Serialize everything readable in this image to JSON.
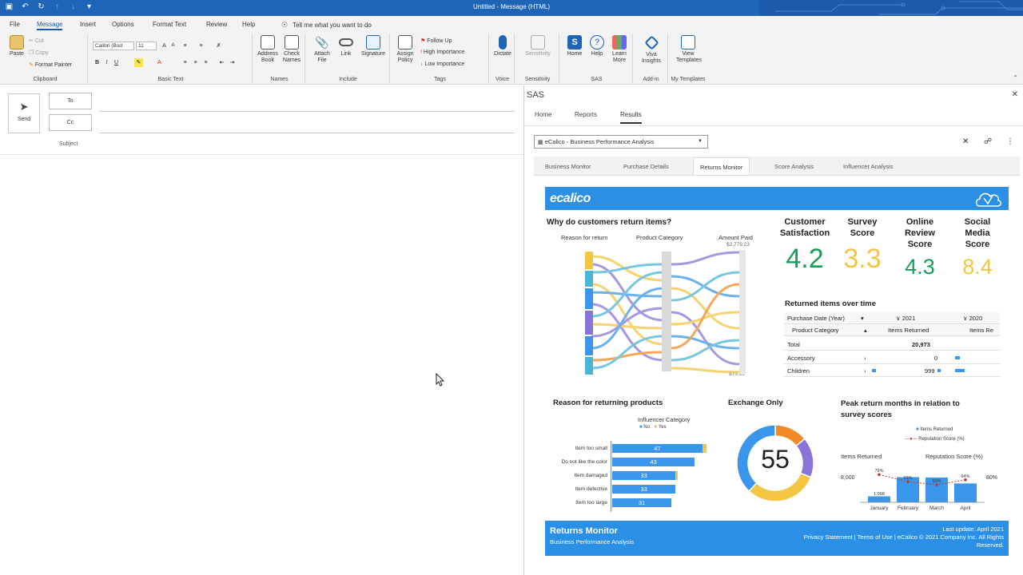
{
  "window": {
    "title": "Untitled - Message (HTML)"
  },
  "menu_tabs": [
    "File",
    "Message",
    "Insert",
    "Options",
    "Format Text",
    "Review",
    "Help"
  ],
  "tell_me": "Tell me what you want to do",
  "ribbon": {
    "clipboard": {
      "label": "Clipboard",
      "paste": "Paste",
      "cut": "Cut",
      "copy": "Copy",
      "format_painter": "Format Painter"
    },
    "basic_text": {
      "label": "Basic Text",
      "font": "Calibri (Bod",
      "size": "11"
    },
    "names": {
      "label": "Names",
      "address_book": [
        "Address",
        "Book"
      ],
      "check_names": [
        "Check",
        "Names"
      ]
    },
    "include": {
      "label": "Include",
      "attach_file": [
        "Attach",
        "File"
      ],
      "link": [
        "Link"
      ],
      "signature": [
        "Signature"
      ]
    },
    "tags": {
      "label": "Tags",
      "assign_policy": [
        "Assign",
        "Policy"
      ],
      "follow_up": "Follow Up",
      "high_importance": "High Importance",
      "low_importance": "Low Importance"
    },
    "voice": {
      "label": "Voice",
      "dictate": [
        "Dictate"
      ]
    },
    "sensitivity": {
      "label": "Sensitivity",
      "sensitivity": [
        "Sensitivity"
      ]
    },
    "sas": {
      "label": "SAS",
      "home": [
        "Home"
      ],
      "help": [
        "Help"
      ],
      "learn_more": [
        "Learn",
        "More"
      ]
    },
    "addin": {
      "label": "Add-in",
      "viva": [
        "Viva",
        "Insights"
      ]
    },
    "templates": {
      "label": "My Templates",
      "view": [
        "View",
        "Templates"
      ]
    }
  },
  "compose": {
    "send": "Send",
    "to": "To",
    "cc": "Cc",
    "subject": "Subject"
  },
  "sas_pane": {
    "title": "SAS",
    "tabs": [
      "Home",
      "Reports",
      "Results"
    ],
    "active_tab": "Results",
    "report_select": "eCalico - Business Performance Analysis",
    "report_tabs": [
      "Business Monitor",
      "Purchase Details",
      "Returns Monitor",
      "Score Analysis",
      "Influencer Analysis"
    ],
    "active_report_tab": "Returns Monitor"
  },
  "report": {
    "logo": "ecalico",
    "why_return": {
      "title": "Why do customers return items?",
      "col1": "Reason for return",
      "col2": "Product Category",
      "col3": "Amount Paid",
      "max": "$2,779.23",
      "min": "$75.35"
    },
    "kpis": [
      {
        "label": [
          "Customer",
          "Satisfaction"
        ],
        "value": "4.2",
        "color": "#1a9c5a"
      },
      {
        "label": [
          "Survey",
          "Score"
        ],
        "value": "3.3",
        "color": "#f4c542"
      },
      {
        "label": [
          "Online",
          "Review",
          "Score"
        ],
        "value": "4.3",
        "color": "#1a9c5a"
      },
      {
        "label": [
          "Social",
          "Media",
          "Score"
        ],
        "value": "8.4",
        "color": "#f4c542"
      }
    ],
    "returned_over_time": {
      "title": "Returned items over time",
      "h_period": "Purchase Date (Year)",
      "y2021": "2021",
      "y2020": "2020",
      "h_cat": "Product Category",
      "h_items": "Items Returned",
      "h_items2": "Items Re",
      "rows": [
        {
          "name": "Total",
          "value": "20,973"
        },
        {
          "name": "Accessory",
          "value": "0"
        },
        {
          "name": "Children",
          "value": "999"
        }
      ]
    },
    "reasons": {
      "title": "Reason for returning products",
      "legend_title": "Influencer Category",
      "legend": [
        "No",
        "Yes"
      ],
      "items": [
        {
          "label": "Item too small",
          "value": 47
        },
        {
          "label": "Do not like the color",
          "value": 43
        },
        {
          "label": "Item damaged",
          "value": 33
        },
        {
          "label": "Item defective",
          "value": 33
        },
        {
          "label": "Item too large",
          "value": 31
        }
      ]
    },
    "exchange": {
      "title": "Exchange Only",
      "value": "55"
    },
    "peak": {
      "title": [
        "Peak return months in relation to",
        "survey scores"
      ],
      "legend_items": "Items Returned",
      "legend_rep": "Reputation Score (%)",
      "left_axis": "Items Returned",
      "right_axis": "Reputation Score (%)",
      "y_left_tick": "8,000",
      "y_right_tick": "80%",
      "months": [
        "January",
        "February",
        "March",
        "April"
      ],
      "point_labels": [
        "79%",
        "59%",
        "50%",
        "64%"
      ],
      "first_bar_label": "1,998"
    },
    "footer": {
      "title": "Returns Monitor",
      "subtitle": "Business Performance Analysis",
      "last_update": "Last update: April 2021",
      "links": "Privacy Statement | Terms of Use | eCalico © 2021 Company Inc. All Rights Reserved."
    }
  },
  "chart_data": [
    {
      "type": "bar",
      "title": "Reason for returning products",
      "categories": [
        "Item too small",
        "Do not like the color",
        "Item damaged",
        "Item defective",
        "Item too large"
      ],
      "series": [
        {
          "name": "No",
          "values": [
            47,
            43,
            33,
            33,
            31
          ]
        }
      ],
      "legend": [
        "No",
        "Yes"
      ]
    },
    {
      "type": "pie",
      "title": "Exchange Only",
      "center_value": 55,
      "slices": [
        {
          "name": "blue",
          "value": 38,
          "color": "#3a96ea"
        },
        {
          "name": "yellow",
          "value": 31,
          "color": "#f4c542"
        },
        {
          "name": "purple",
          "value": 17,
          "color": "#8b74d8"
        },
        {
          "name": "orange",
          "value": 14,
          "color": "#f08a24"
        }
      ]
    },
    {
      "type": "bar",
      "title": "Peak return months in relation to survey scores",
      "categories": [
        "January",
        "February",
        "March",
        "April"
      ],
      "series": [
        {
          "name": "Items Returned",
          "values": [
            1998,
            8400,
            8300,
            6300
          ]
        },
        {
          "name": "Reputation Score (%)",
          "values": [
            79,
            59,
            50,
            64
          ]
        }
      ]
    }
  ],
  "colors": {
    "outlook_blue": "#1e64b7",
    "sas_blue": "#2b8fe6",
    "green": "#1a9c5a",
    "yellow": "#f4c542"
  }
}
